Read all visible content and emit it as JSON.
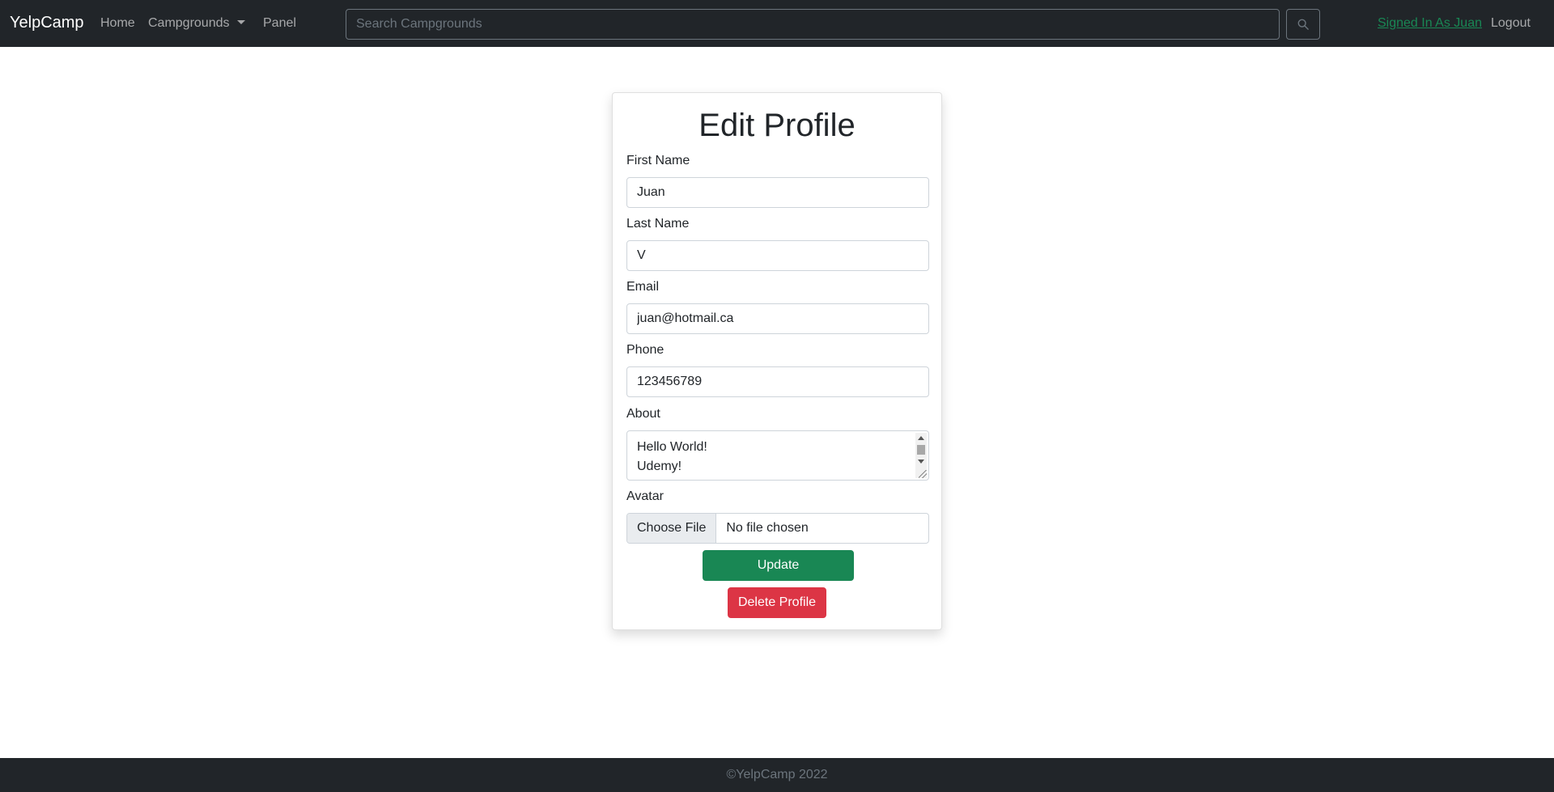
{
  "navbar": {
    "brand": "YelpCamp",
    "links": {
      "home": "Home",
      "campgrounds": "Campgrounds",
      "panel": "Panel"
    },
    "search": {
      "placeholder": "Search Campgrounds",
      "icon": "search-icon"
    },
    "signed_in": "Signed In As Juan",
    "logout": "Logout"
  },
  "form": {
    "title": "Edit Profile",
    "fields": {
      "first_name": {
        "label": "First Name",
        "value": "Juan"
      },
      "last_name": {
        "label": "Last Name",
        "value": "V"
      },
      "email": {
        "label": "Email",
        "value": "juan@hotmail.ca"
      },
      "phone": {
        "label": "Phone",
        "value": "123456789"
      },
      "about": {
        "label": "About",
        "lines": [
          "Hello World!",
          "Udemy!"
        ]
      },
      "avatar": {
        "label": "Avatar",
        "button": "Choose File",
        "status": "No file chosen"
      }
    },
    "update_label": "Update",
    "delete_label": "Delete Profile"
  },
  "footer": {
    "text": "©YelpCamp 2022"
  },
  "colors": {
    "navbar_bg": "#212529",
    "success": "#198754",
    "danger": "#dc3545",
    "muted": "#6c757d"
  }
}
